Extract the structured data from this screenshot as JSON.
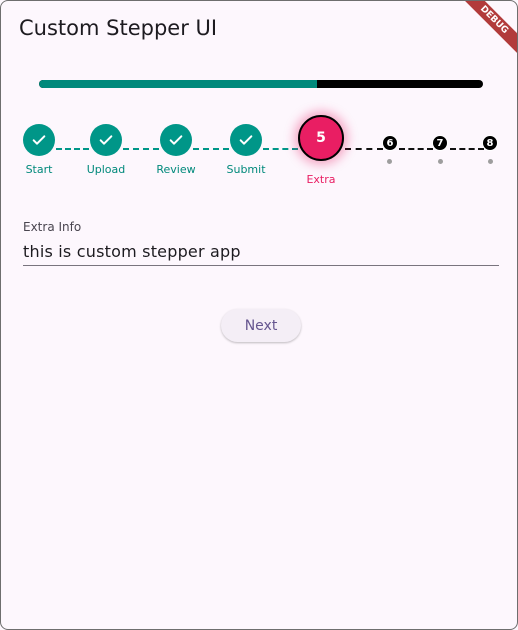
{
  "app": {
    "title": "Custom Stepper UI",
    "debug_banner": "DEBUG"
  },
  "progress": {
    "fraction": 0.625,
    "fill_color": "#00897b",
    "track_color": "#000000"
  },
  "stepper": {
    "completed_steps": [
      {
        "label": "Start",
        "icon": "check-icon"
      },
      {
        "label": "Upload",
        "icon": "check-icon"
      },
      {
        "label": "Review",
        "icon": "check-icon"
      },
      {
        "label": "Submit",
        "icon": "check-icon"
      }
    ],
    "current_step": {
      "number": "5",
      "label": "Extra"
    },
    "future_steps": [
      {
        "number": "6"
      },
      {
        "number": "7"
      },
      {
        "number": "8"
      }
    ],
    "colors": {
      "completed": "#009688",
      "current": "#e91e63",
      "future": "#000000"
    }
  },
  "form": {
    "field_label": "Extra Info",
    "field_value": "this is custom stepper app"
  },
  "actions": {
    "next_label": "Next"
  }
}
